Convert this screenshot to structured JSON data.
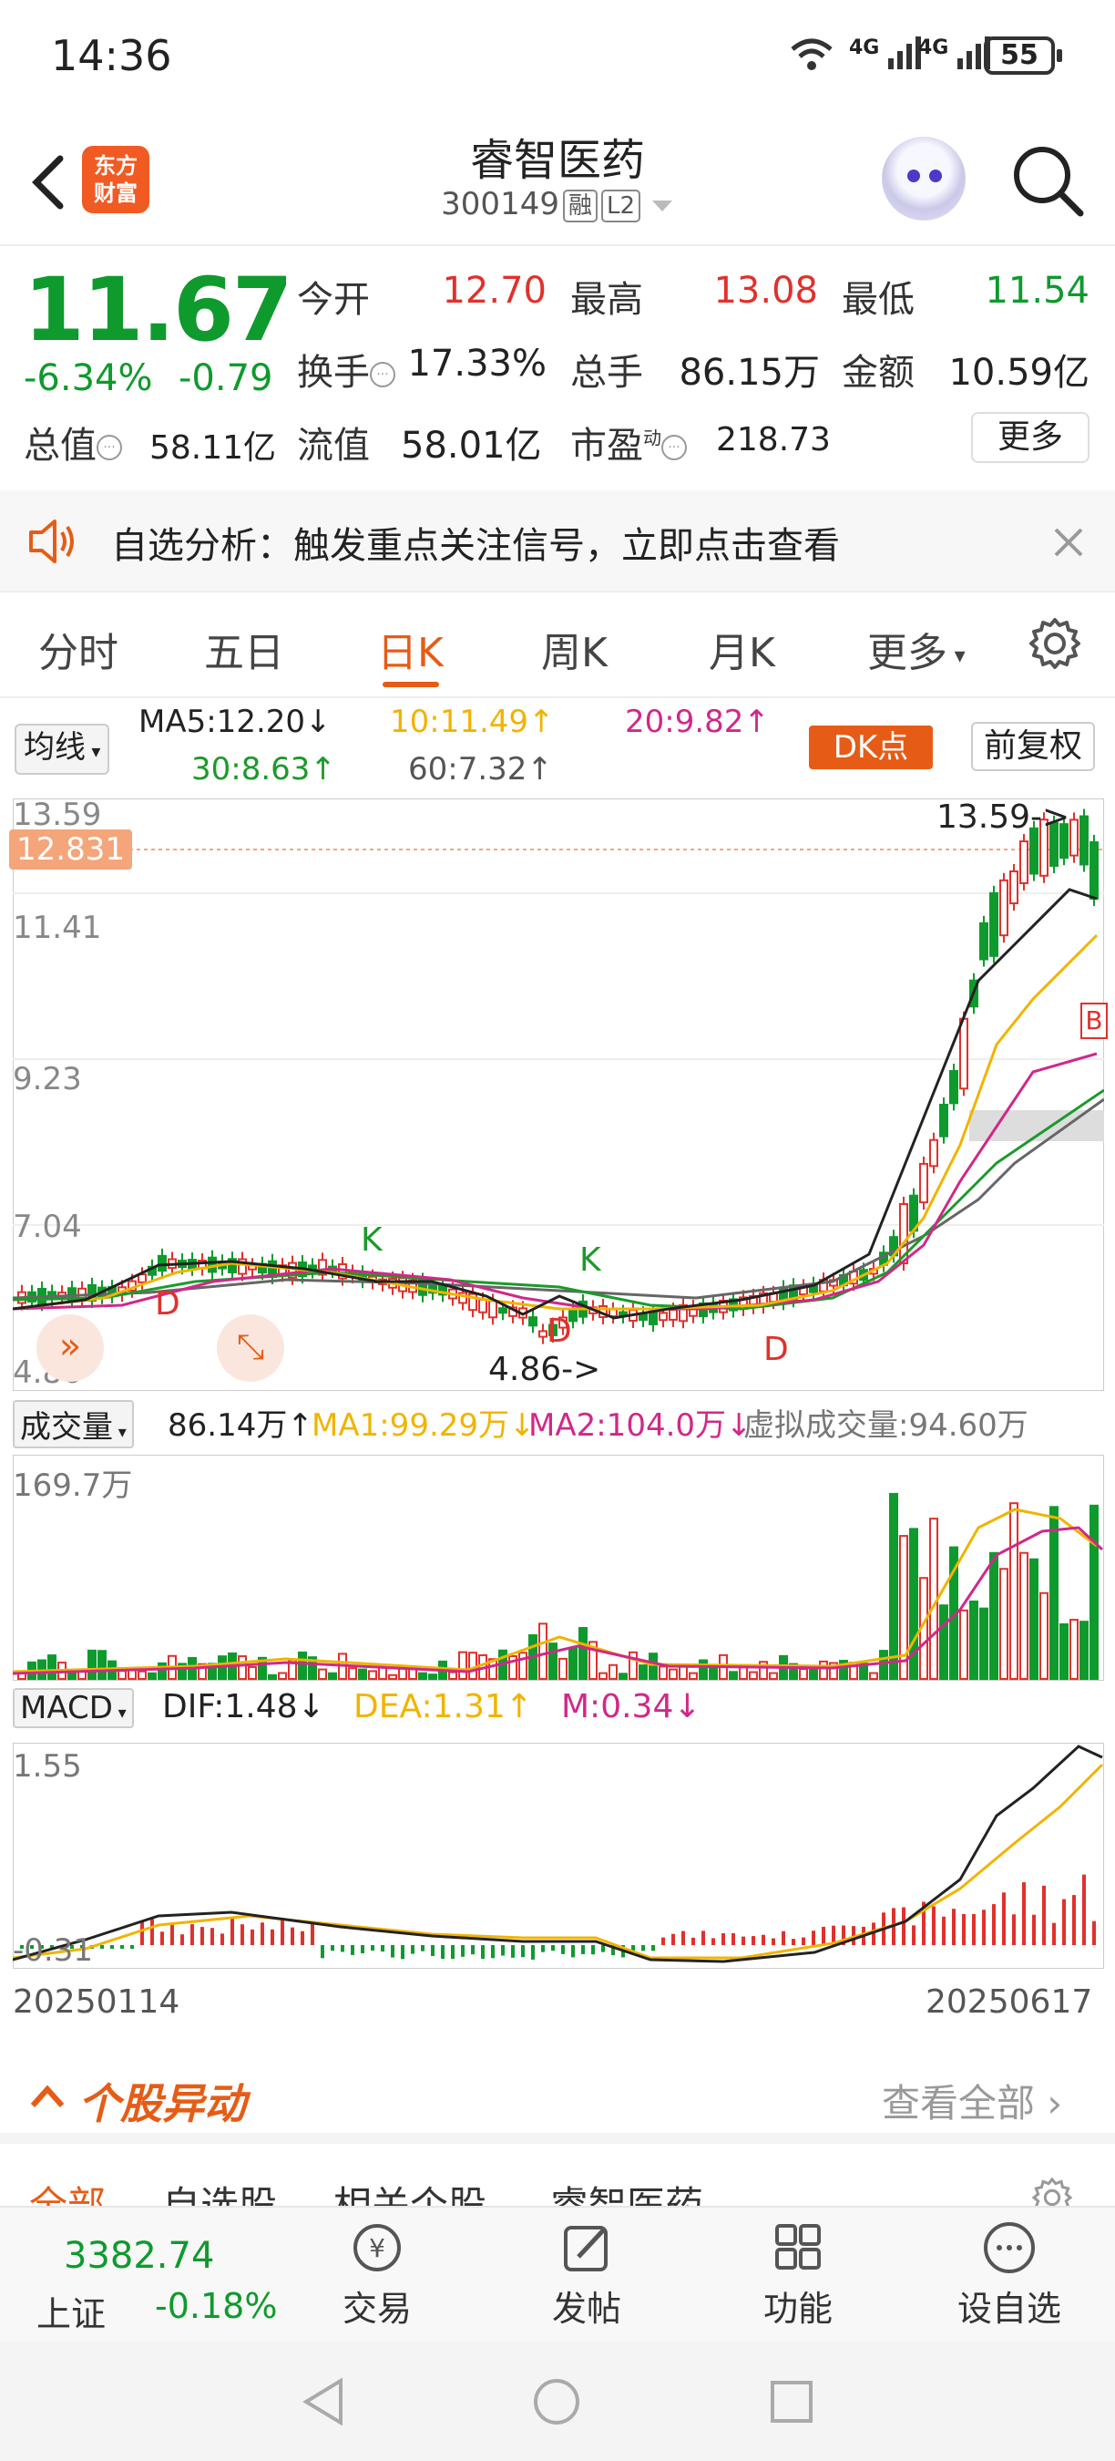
{
  "status_bar": {
    "time": "14:36",
    "battery": "55",
    "signal_1": "4G",
    "signal_2": "4G"
  },
  "header": {
    "logo_line1": "东方",
    "logo_line2": "财富",
    "stock_name": "睿智医药",
    "stock_code": "300149",
    "tag_margin": "融",
    "tag_level": "L2"
  },
  "quote": {
    "price": "11.67",
    "change_pct": "-6.34%",
    "change_amt": "-0.79",
    "open_label": "今开",
    "open": "12.70",
    "high_label": "最高",
    "high": "13.08",
    "low_label": "最低",
    "low": "11.54",
    "turnover_label": "换手",
    "turnover": "17.33%",
    "volume_label": "总手",
    "volume": "86.15万",
    "amount_label": "金额",
    "amount": "10.59亿",
    "mktcap_label": "总值",
    "mktcap": "58.11亿",
    "float_label": "流值",
    "float": "58.01亿",
    "pe_label": "市盈",
    "pe_sup": "动",
    "pe": "218.73",
    "more": "更多"
  },
  "notice": {
    "text": "自选分析：触发重点关注信号，立即点击查看"
  },
  "tabs": [
    "分时",
    "五日",
    "日K",
    "周K",
    "月K",
    "更多"
  ],
  "ma": {
    "selector": "均线",
    "ma5": "MA5:12.20↓",
    "ma10": "10:11.49↑",
    "ma20": "20:9.82↑",
    "ma30": "30:8.63↑",
    "ma60": "60:7.32↑",
    "dk": "DK点",
    "adjust": "前复权"
  },
  "kline": {
    "axis_labels": [
      "13.59",
      "11.41",
      "9.23",
      "7.04",
      "4.86"
    ],
    "crosshair": "12.831",
    "max_note": "13.59->",
    "min_note": "4.86->",
    "markers": [
      "D",
      "K",
      "D",
      "K",
      "D"
    ],
    "b_marker": "B"
  },
  "volume": {
    "selector": "成交量",
    "value": "86.14万↑",
    "ma1": "MA1:99.29万↓",
    "ma2": "MA2:104.0万↓",
    "virtual": "虚拟成交量:94.60万",
    "axis_max": "169.7万"
  },
  "macd": {
    "selector": "MACD",
    "dif": "DIF:1.48↓",
    "dea": "DEA:1.31↑",
    "m": "M:0.34↓",
    "axis_max": "1.55",
    "axis_min": "-0.31"
  },
  "date_start": "20250114",
  "date_end": "20250617",
  "section": {
    "title": "个股异动",
    "view_all": "查看全部"
  },
  "sub_tabs": [
    "全部",
    "自选股",
    "相关个股",
    "睿智医药"
  ],
  "bottom_bar": {
    "index_value": "3382.74",
    "index_name": "上证",
    "index_change": "-0.18%",
    "items": [
      "交易",
      "发帖",
      "功能",
      "设自选"
    ]
  },
  "colors": {
    "up": "#e0312c",
    "down": "#0f9a2d",
    "accent": "#e65c16",
    "ma5": "#222222",
    "ma10": "#f0b400",
    "ma20": "#d0288a",
    "ma30": "#1c9a2a",
    "ma60": "#666666"
  }
}
